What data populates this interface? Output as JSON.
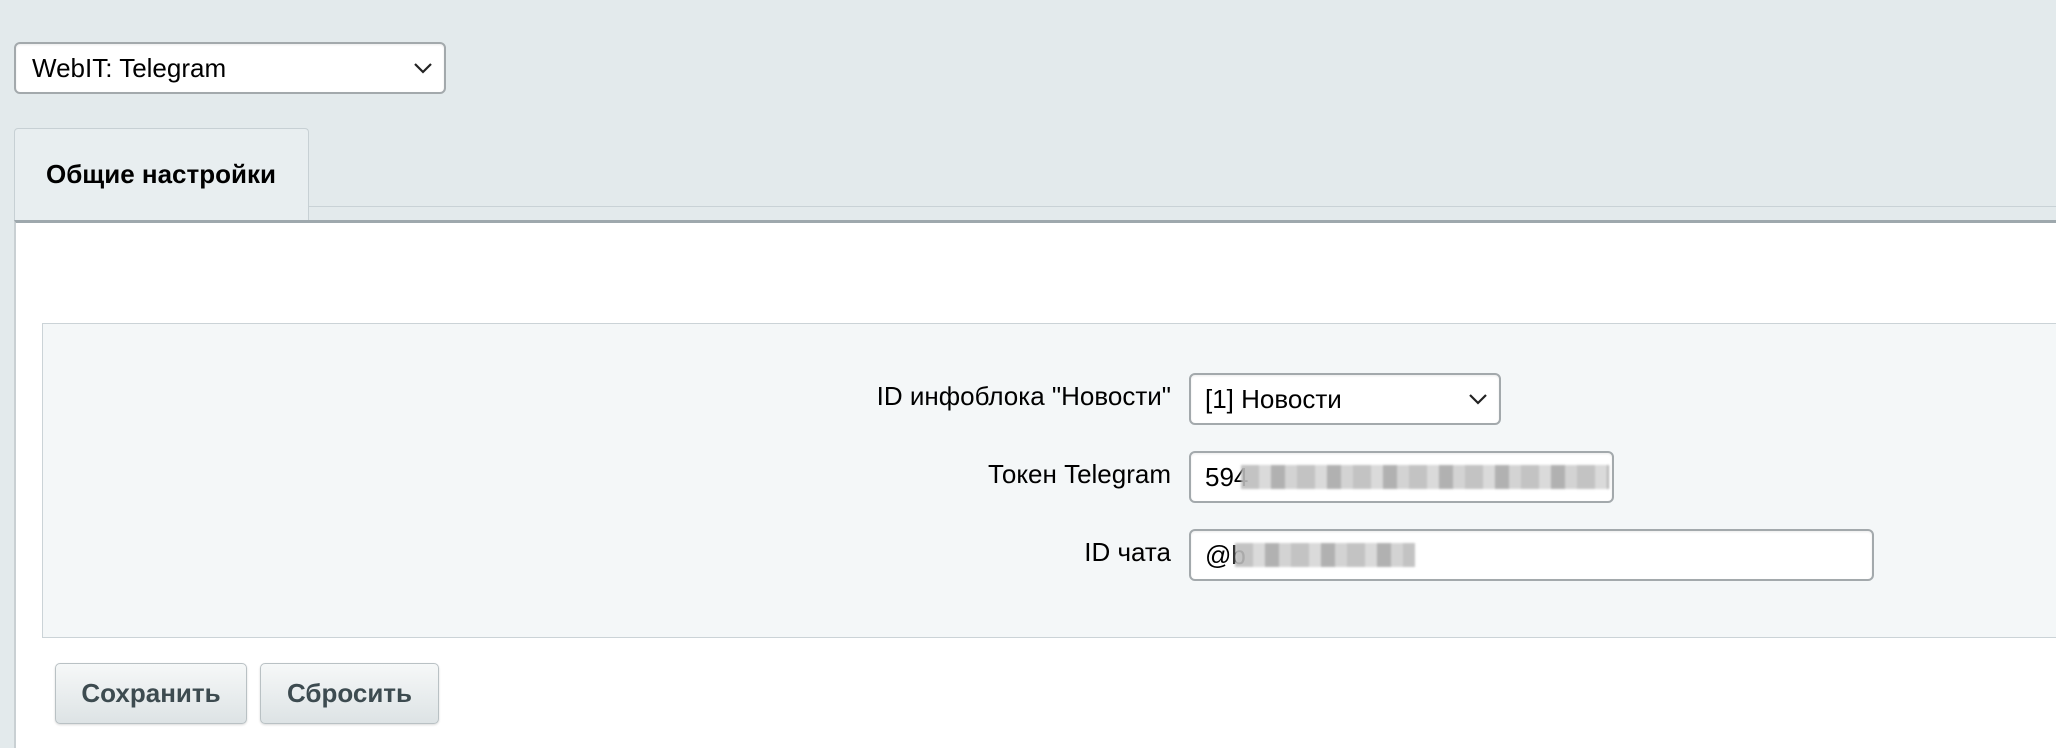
{
  "module_select": {
    "selected": "WebIT: Telegram",
    "icon": "chevron-down-icon"
  },
  "tabs": [
    {
      "label": "Общие настройки",
      "active": true
    }
  ],
  "form": {
    "iblock": {
      "label": "ID инфоблока \"Новости\"",
      "selected": "[1] Новости",
      "icon": "chevron-down-icon"
    },
    "token": {
      "label": "Токен Telegram",
      "value_visible": "594",
      "redacted": true
    },
    "chat": {
      "label": "ID чата",
      "value_visible": "@b",
      "redacted": true
    }
  },
  "buttons": {
    "save": "Сохранить",
    "reset": "Сбросить"
  },
  "colors": {
    "page_background": "#e3eaec",
    "panel_background": "#f4f7f8",
    "button_text": "#3d4b50"
  }
}
